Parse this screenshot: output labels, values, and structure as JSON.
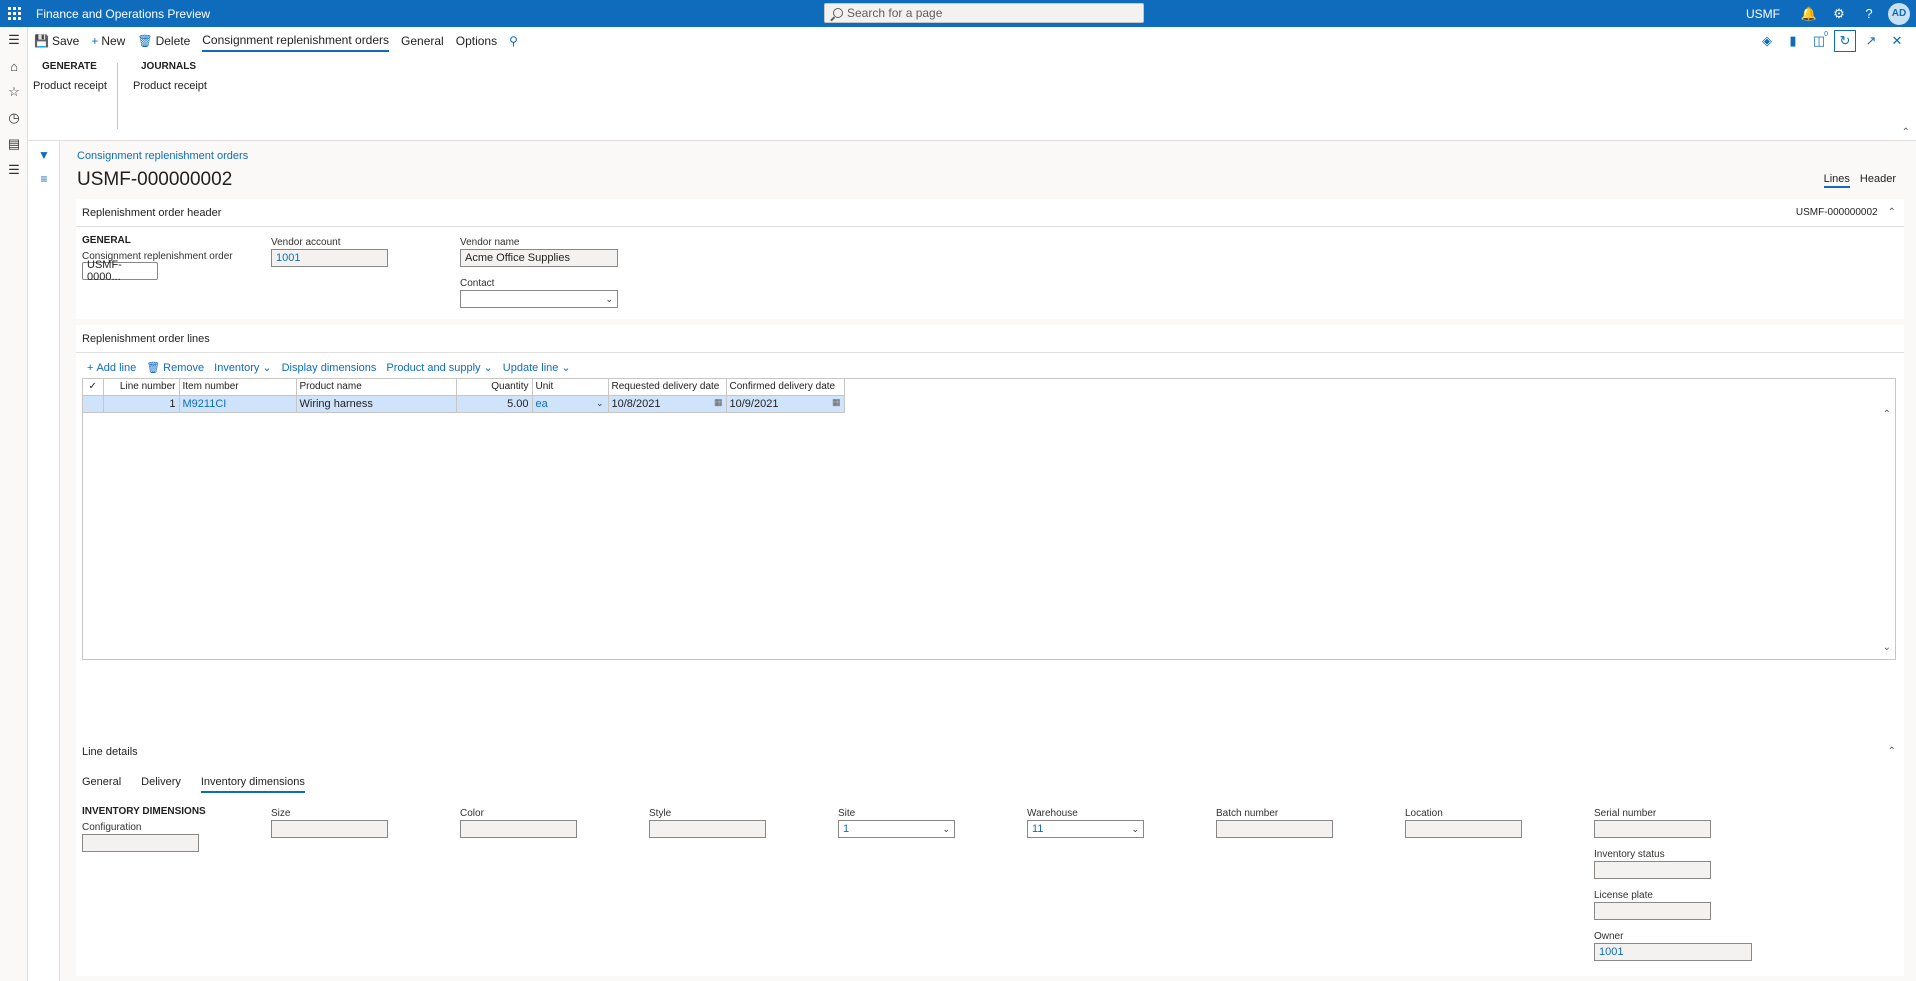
{
  "app": {
    "title": "Finance and Operations Preview",
    "company": "USMF",
    "user_initials": "AD"
  },
  "search": {
    "placeholder": "Search for a page"
  },
  "actionbar": {
    "save": "Save",
    "new": "New",
    "delete": "Delete",
    "tab_active": "Consignment replenishment orders",
    "general": "General",
    "options": "Options",
    "notification_count": "0"
  },
  "ribbon": {
    "groups": [
      {
        "header": "GENERATE",
        "item": "Product receipt"
      },
      {
        "header": "JOURNALS",
        "item": "Product receipt"
      }
    ]
  },
  "page": {
    "breadcrumb": "Consignment replenishment orders",
    "title": "USMF-000000002",
    "view_lines": "Lines",
    "view_header": "Header"
  },
  "header_section": {
    "title": "Replenishment order header",
    "summary": "USMF-000000002",
    "group": "GENERAL",
    "order_label": "Consignment replenishment order",
    "order_value": "USMF-0000...",
    "vendor_account_label": "Vendor account",
    "vendor_account_value": "1001",
    "vendor_name_label": "Vendor name",
    "vendor_name_value": "Acme Office Supplies",
    "contact_label": "Contact",
    "contact_value": ""
  },
  "lines_section": {
    "title": "Replenishment order lines",
    "toolbar": {
      "add_line": "Add line",
      "remove": "Remove",
      "inventory": "Inventory",
      "display_dimensions": "Display dimensions",
      "product_supply": "Product and supply",
      "update_line": "Update line"
    },
    "columns": {
      "line_number": "Line number",
      "item_number": "Item number",
      "product_name": "Product name",
      "quantity": "Quantity",
      "unit": "Unit",
      "requested_date": "Requested delivery date",
      "confirmed_date": "Confirmed delivery date"
    },
    "rows": [
      {
        "line_number": "1",
        "item_number": "M9211CI",
        "product_name": "Wiring harness",
        "quantity": "5.00",
        "unit": "ea",
        "requested_date": "10/8/2021",
        "confirmed_date": "10/9/2021"
      }
    ]
  },
  "details_section": {
    "title": "Line details",
    "tabs": {
      "general": "General",
      "delivery": "Delivery",
      "inventory_dimensions": "Inventory dimensions"
    },
    "group": "INVENTORY DIMENSIONS",
    "fields": {
      "configuration": {
        "label": "Configuration",
        "value": ""
      },
      "size": {
        "label": "Size",
        "value": ""
      },
      "color": {
        "label": "Color",
        "value": ""
      },
      "style": {
        "label": "Style",
        "value": ""
      },
      "site": {
        "label": "Site",
        "value": "1"
      },
      "warehouse": {
        "label": "Warehouse",
        "value": "11"
      },
      "batch": {
        "label": "Batch number",
        "value": ""
      },
      "location": {
        "label": "Location",
        "value": ""
      },
      "serial": {
        "label": "Serial number",
        "value": ""
      },
      "inventory_status": {
        "label": "Inventory status",
        "value": ""
      },
      "license_plate": {
        "label": "License plate",
        "value": ""
      },
      "owner": {
        "label": "Owner",
        "value": "1001"
      }
    }
  }
}
